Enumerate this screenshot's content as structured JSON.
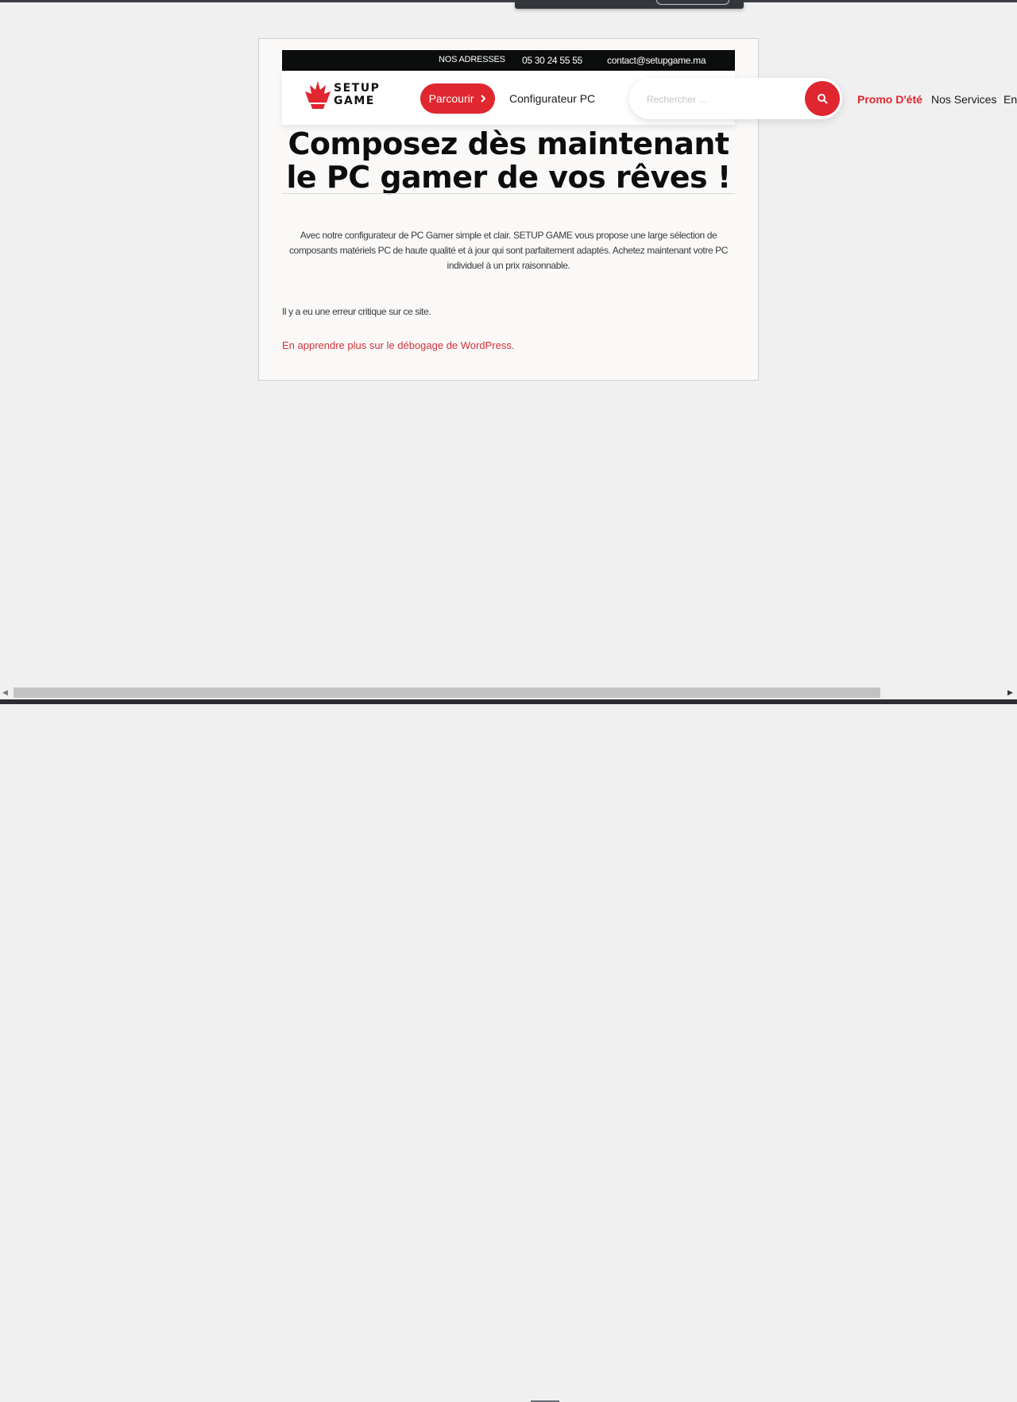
{
  "colors": {
    "accent": "#e0262e",
    "topbar_bg": "#0b0d0d",
    "page_bg": "#f0f0f0"
  },
  "topbar": {
    "addresses": "NOS ADRESSES",
    "phone": "05 30 24 55 55",
    "email": "contact@setupgame.ma"
  },
  "logo": {
    "line1": "SETUP",
    "line2": "GAME",
    "icon": "crown-logo-icon"
  },
  "nav": {
    "browse_label": "Parcourir",
    "configurator_label": "Configurateur PC",
    "promo_label": "Promo D'été",
    "services_label": "Nos Services",
    "next_item_partial": "Ent"
  },
  "search": {
    "placeholder": "Rechercher ...",
    "icon": "search-icon"
  },
  "main": {
    "headline": "Composez dès maintenant le PC gamer de vos rêves !",
    "intro": "Avec notre configurateur de PC Gamer simple et clair. SETUP GAME vous propose une large sélection de composants matériels PC de haute qualité et à jour qui sont parfaitement adaptés. Achetez maintenant votre PC individuel à un prix raisonnable.",
    "error_message": "Il y a eu une erreur critique sur ce site.",
    "error_link": "En apprendre plus sur le débogage de WordPress."
  }
}
